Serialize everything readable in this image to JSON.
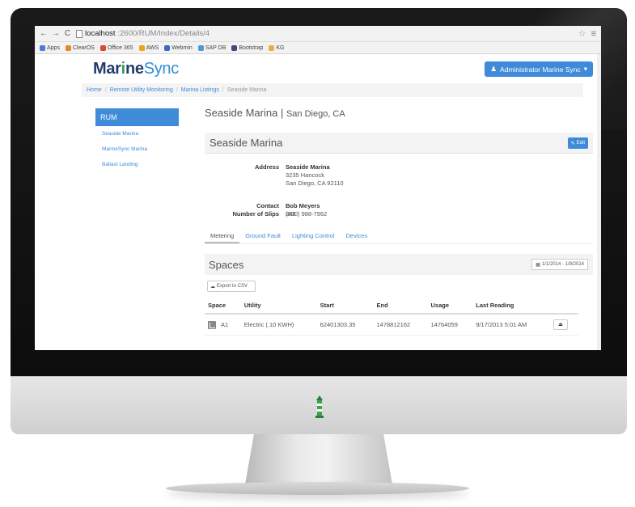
{
  "browser": {
    "url_host": "localhost",
    "url_path": ":2600/RUM/Index/Details/4",
    "bookmarks": [
      {
        "label": "Apps",
        "color": "#4f7ad8"
      },
      {
        "label": "ClearOS",
        "color": "#e08a2c"
      },
      {
        "label": "Office 365",
        "color": "#d84a2f"
      },
      {
        "label": "AWS",
        "color": "#f0a21b"
      },
      {
        "label": "Webmin",
        "color": "#3a6bbf"
      },
      {
        "label": "SAP DB",
        "color": "#4a9ad3"
      },
      {
        "label": "Bootstrap",
        "color": "#563d7c"
      },
      {
        "label": "KG",
        "color": "#e2b23a"
      }
    ]
  },
  "brand": {
    "mar": "Mar",
    "i": "i",
    "ne": "ne",
    "sync": "Sync"
  },
  "header": {
    "admin_label": "Administrator Marine Sync"
  },
  "breadcrumb": [
    "Home",
    "Remote Utility Monitoring",
    "Marina Listings",
    "Seaside Marina"
  ],
  "sidebar": {
    "title": "RUM",
    "items": [
      "Seaside Marina",
      "MarineSync Marina",
      "Ballast Landing"
    ]
  },
  "main": {
    "title": "Seaside Marina",
    "title_location": "San Diego, CA",
    "panel_title": "Seaside Marina",
    "edit_label": "Edit",
    "address_label": "Address",
    "address_name": "Seaside Marina",
    "address_line1": "3235 Hancock",
    "address_line2": "San Diego, CA 92110",
    "contact_label": "Contact",
    "contact_name": "Bob Meyers",
    "contact_phone": "(800) 988-7962",
    "slips_label": "Number of Slips",
    "slips_value": "248",
    "tabs": [
      "Metering",
      "Ground Fault",
      "Lighting Control",
      "Devices"
    ]
  },
  "spaces": {
    "title": "Spaces",
    "date_range": "1/1/2014 - 1/9/2014",
    "export_label": "Export to CSV",
    "columns": [
      "Space",
      "Utility",
      "Start",
      "End",
      "Usage",
      "Last Reading"
    ],
    "rows": [
      {
        "space": "A1",
        "utility": "Electric (.10 KWH)",
        "start": "62401303.35",
        "end": "1478812162",
        "usage": "14764059",
        "last_reading": "9/17/2013 5:01 AM"
      }
    ]
  }
}
